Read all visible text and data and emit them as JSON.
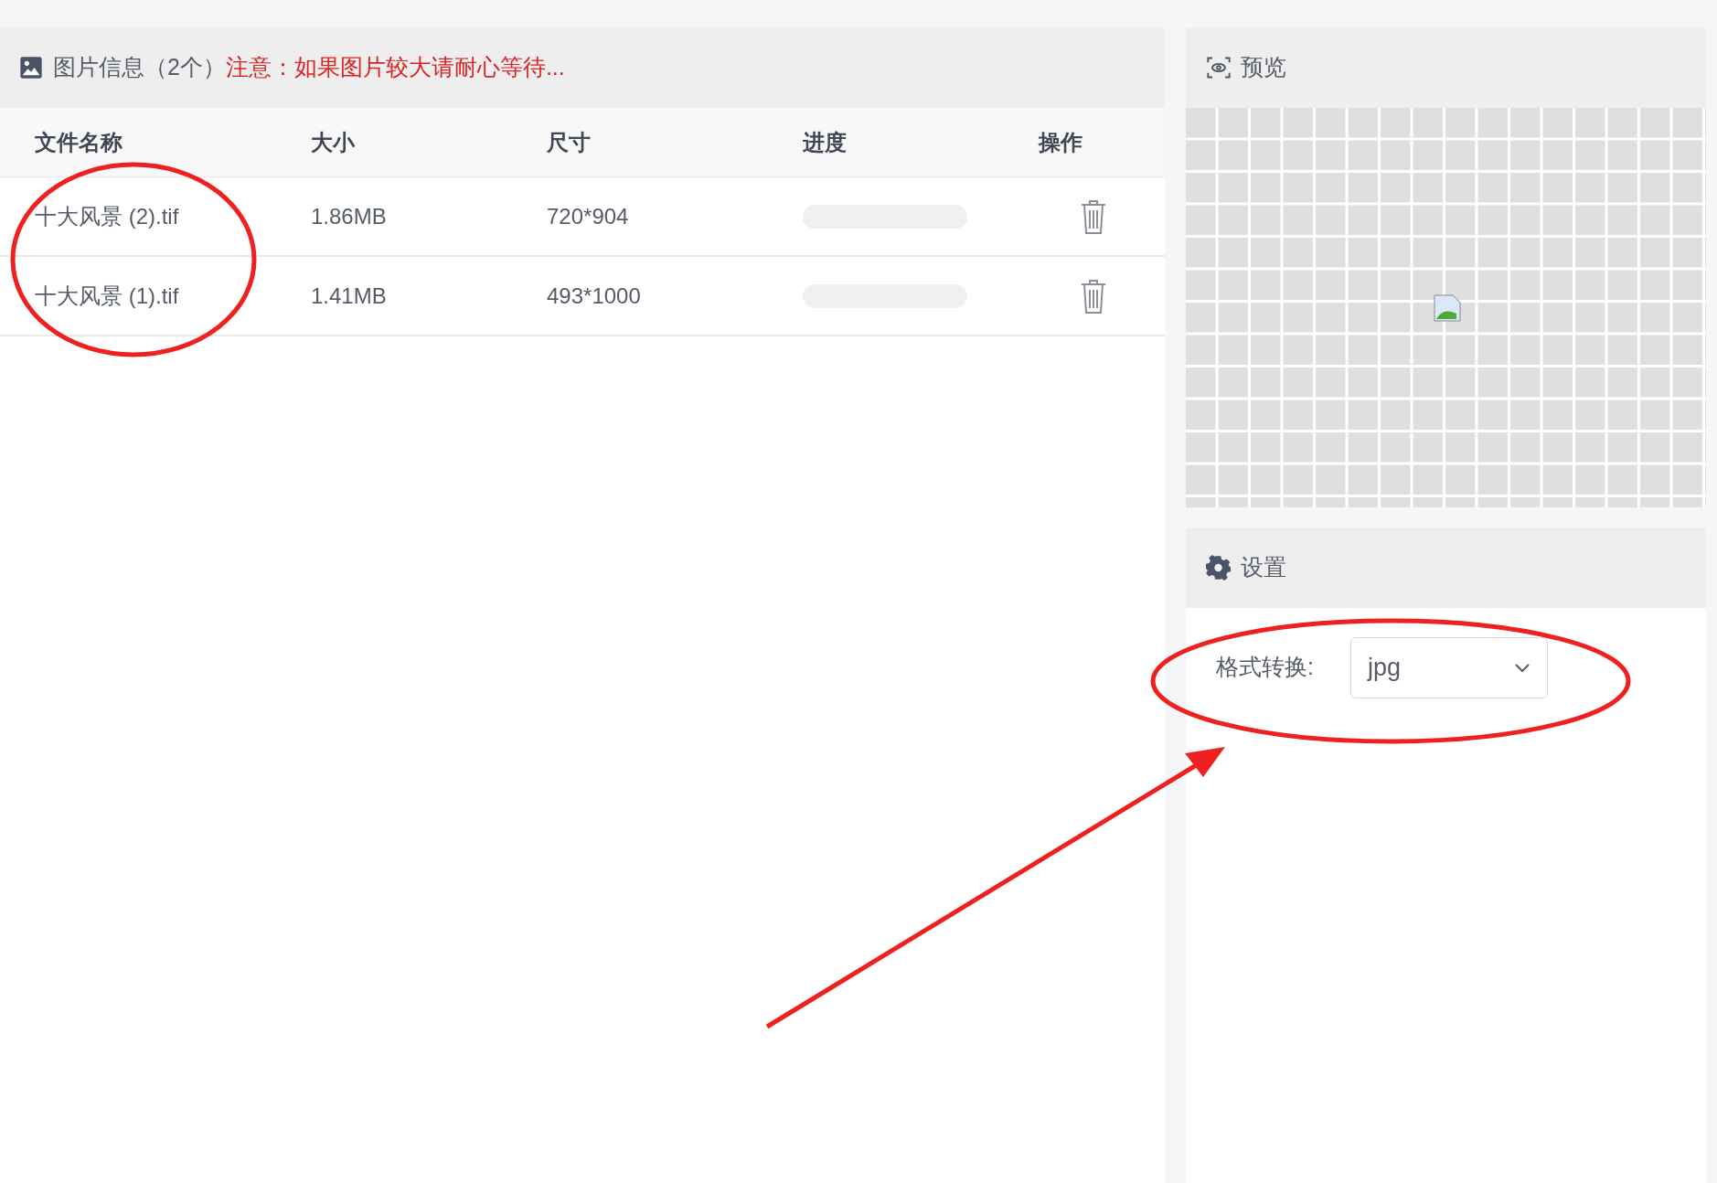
{
  "file_panel": {
    "title": "图片信息（2个）",
    "notice": "注意：如果图片较大请耐心等待...",
    "columns": [
      "文件名称",
      "大小",
      "尺寸",
      "进度",
      "操作"
    ],
    "rows": [
      {
        "name": "十大风景 (2).tif",
        "size": "1.86MB",
        "dimensions": "720*904",
        "level": 0
      },
      {
        "name": "十大风景 (1).tif",
        "size": "1.41MB",
        "dimensions": "493*1000",
        "level": 0
      }
    ]
  },
  "preview": {
    "title": "预览"
  },
  "settings": {
    "title": "设置",
    "format_label": "格式转换:",
    "format_value": "jpg"
  }
}
